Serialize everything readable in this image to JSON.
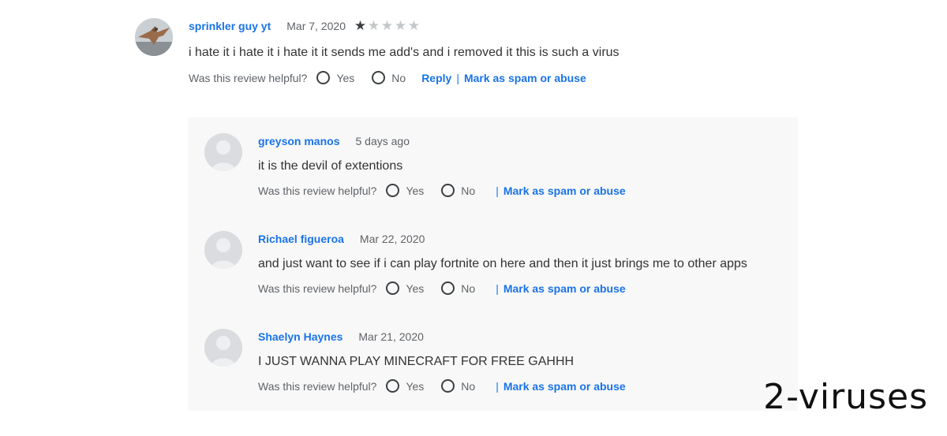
{
  "main_review": {
    "author": "sprinkler guy yt",
    "date": "Mar 7, 2020",
    "rating": 1,
    "rating_max": 5,
    "text": "i hate it i hate it i hate it it sends me add's and i removed it this is such a virus",
    "helpful_prompt": "Was this review helpful?",
    "yes_label": "Yes",
    "no_label": "No",
    "reply_label": "Reply",
    "separator": "|",
    "spam_label": "Mark as spam or abuse"
  },
  "replies": [
    {
      "author": "greyson manos",
      "date": "5 days ago",
      "text": "it is the devil of extentions",
      "helpful_prompt": "Was this review helpful?",
      "yes_label": "Yes",
      "no_label": "No",
      "separator": "|",
      "spam_label": "Mark as spam or abuse"
    },
    {
      "author": "Richael figueroa",
      "date": "Mar 22, 2020",
      "text": "and just want to see if i can play fortnite on here and then it just brings me to other apps",
      "helpful_prompt": "Was this review helpful?",
      "yes_label": "Yes",
      "no_label": "No",
      "separator": "|",
      "spam_label": "Mark as spam or abuse"
    },
    {
      "author": "Shaelyn Haynes",
      "date": "Mar 21, 2020",
      "text": "I JUST WANNA PLAY MINECRAFT FOR FREE GAHHH",
      "helpful_prompt": "Was this review helpful?",
      "yes_label": "Yes",
      "no_label": "No",
      "separator": "|",
      "spam_label": "Mark as spam or abuse"
    }
  ],
  "watermark": "2-viruses",
  "colors": {
    "link": "#1a73e8",
    "reply_panel_bg": "#f8f8f8",
    "star_filled": "#3c4043",
    "star_empty": "#c4c7c9"
  },
  "icons": {
    "star": "star-icon",
    "radio": "radio-button-icon",
    "default_avatar": "default-person-icon"
  }
}
